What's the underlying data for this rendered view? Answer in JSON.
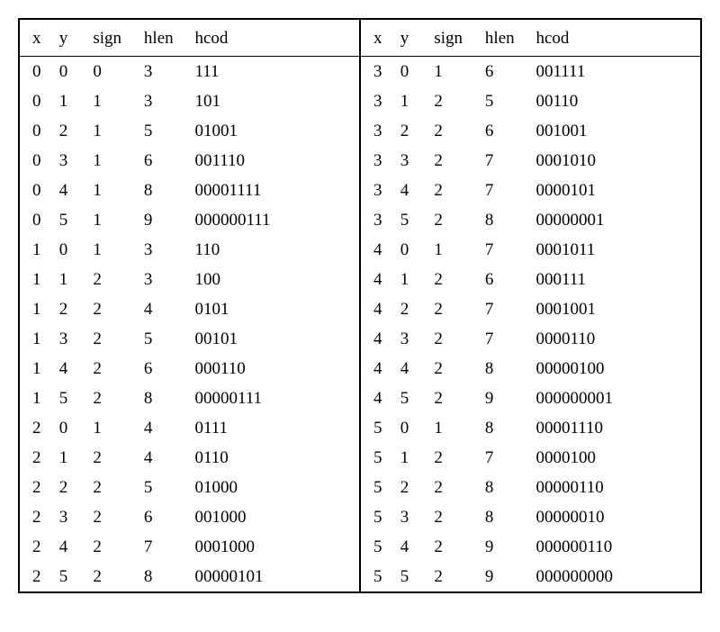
{
  "headers": {
    "x": "x",
    "y": "y",
    "sign": "sign",
    "hlen": "hlen",
    "hcod": "hcod"
  },
  "left": [
    {
      "x": "0",
      "y": "0",
      "sign": "0",
      "hlen": "3",
      "hcod": "111"
    },
    {
      "x": "0",
      "y": "1",
      "sign": "1",
      "hlen": "3",
      "hcod": "101"
    },
    {
      "x": "0",
      "y": "2",
      "sign": "1",
      "hlen": "5",
      "hcod": "01001"
    },
    {
      "x": "0",
      "y": "3",
      "sign": "1",
      "hlen": "6",
      "hcod": "001110"
    },
    {
      "x": "0",
      "y": "4",
      "sign": "1",
      "hlen": "8",
      "hcod": "00001111"
    },
    {
      "x": "0",
      "y": "5",
      "sign": "1",
      "hlen": "9",
      "hcod": "000000111"
    },
    {
      "x": "1",
      "y": "0",
      "sign": "1",
      "hlen": "3",
      "hcod": "110"
    },
    {
      "x": "1",
      "y": "1",
      "sign": "2",
      "hlen": "3",
      "hcod": "100"
    },
    {
      "x": "1",
      "y": "2",
      "sign": "2",
      "hlen": "4",
      "hcod": "0101"
    },
    {
      "x": "1",
      "y": "3",
      "sign": "2",
      "hlen": "5",
      "hcod": "00101"
    },
    {
      "x": "1",
      "y": "4",
      "sign": "2",
      "hlen": "6",
      "hcod": "000110"
    },
    {
      "x": "1",
      "y": "5",
      "sign": "2",
      "hlen": "8",
      "hcod": "00000111"
    },
    {
      "x": "2",
      "y": "0",
      "sign": "1",
      "hlen": "4",
      "hcod": "0111"
    },
    {
      "x": "2",
      "y": "1",
      "sign": "2",
      "hlen": "4",
      "hcod": "0110"
    },
    {
      "x": "2",
      "y": "2",
      "sign": "2",
      "hlen": "5",
      "hcod": "01000"
    },
    {
      "x": "2",
      "y": "3",
      "sign": "2",
      "hlen": "6",
      "hcod": "001000"
    },
    {
      "x": "2",
      "y": "4",
      "sign": "2",
      "hlen": "7",
      "hcod": "0001000"
    },
    {
      "x": "2",
      "y": "5",
      "sign": "2",
      "hlen": "8",
      "hcod": "00000101"
    }
  ],
  "right": [
    {
      "x": "3",
      "y": "0",
      "sign": "1",
      "hlen": "6",
      "hcod": "001111"
    },
    {
      "x": "3",
      "y": "1",
      "sign": "2",
      "hlen": "5",
      "hcod": "00110"
    },
    {
      "x": "3",
      "y": "2",
      "sign": "2",
      "hlen": "6",
      "hcod": "001001"
    },
    {
      "x": "3",
      "y": "3",
      "sign": "2",
      "hlen": "7",
      "hcod": "0001010"
    },
    {
      "x": "3",
      "y": "4",
      "sign": "2",
      "hlen": "7",
      "hcod": "0000101"
    },
    {
      "x": "3",
      "y": "5",
      "sign": "2",
      "hlen": "8",
      "hcod": "00000001"
    },
    {
      "x": "4",
      "y": "0",
      "sign": "1",
      "hlen": "7",
      "hcod": "0001011"
    },
    {
      "x": "4",
      "y": "1",
      "sign": "2",
      "hlen": "6",
      "hcod": "000111"
    },
    {
      "x": "4",
      "y": "2",
      "sign": "2",
      "hlen": "7",
      "hcod": "0001001"
    },
    {
      "x": "4",
      "y": "3",
      "sign": "2",
      "hlen": "7",
      "hcod": "0000110"
    },
    {
      "x": "4",
      "y": "4",
      "sign": "2",
      "hlen": "8",
      "hcod": "00000100"
    },
    {
      "x": "4",
      "y": "5",
      "sign": "2",
      "hlen": "9",
      "hcod": "000000001"
    },
    {
      "x": "5",
      "y": "0",
      "sign": "1",
      "hlen": "8",
      "hcod": "00001110"
    },
    {
      "x": "5",
      "y": "1",
      "sign": "2",
      "hlen": "7",
      "hcod": "0000100"
    },
    {
      "x": "5",
      "y": "2",
      "sign": "2",
      "hlen": "8",
      "hcod": "00000110"
    },
    {
      "x": "5",
      "y": "3",
      "sign": "2",
      "hlen": "8",
      "hcod": "00000010"
    },
    {
      "x": "5",
      "y": "4",
      "sign": "2",
      "hlen": "9",
      "hcod": "000000110"
    },
    {
      "x": "5",
      "y": "5",
      "sign": "2",
      "hlen": "9",
      "hcod": "000000000"
    }
  ]
}
